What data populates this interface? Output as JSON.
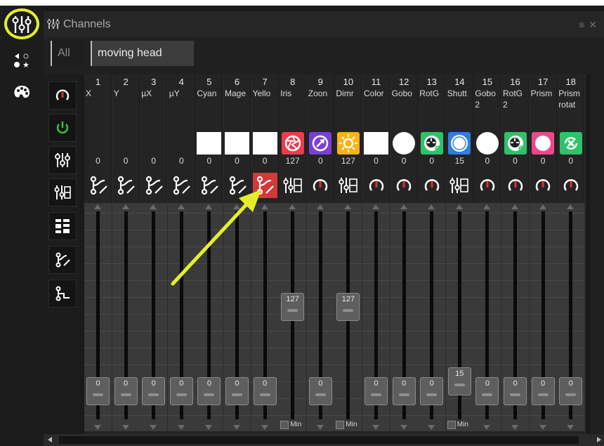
{
  "window": {
    "title": "Channels",
    "controls": [
      "≡",
      "✕"
    ]
  },
  "tabs": [
    {
      "label": "All",
      "active": false
    },
    {
      "label": "moving head",
      "active": true
    }
  ],
  "accent": "#e4ef2a",
  "left_toolbar": [
    {
      "icon": "faders-icon",
      "highlighted": true
    },
    {
      "icon": "effects-icon"
    },
    {
      "icon": "palette-icon"
    }
  ],
  "tools": [
    {
      "icon": "knob-icon"
    },
    {
      "icon": "power-icon"
    },
    {
      "icon": "faders-mode-icon"
    },
    {
      "icon": "faders-default-icon"
    },
    {
      "icon": "layout-grid-icon"
    },
    {
      "icon": "branch-curve-icon"
    },
    {
      "icon": "branch-step-icon"
    }
  ],
  "channels": [
    {
      "num": "1",
      "name": "X",
      "value": "0",
      "swatch": "none",
      "mode": "curve",
      "fader": "0"
    },
    {
      "num": "2",
      "name": "Y",
      "value": "0",
      "swatch": "none",
      "mode": "curve",
      "fader": "0"
    },
    {
      "num": "3",
      "name": "µX",
      "value": "0",
      "swatch": "none",
      "mode": "curve",
      "fader": "0"
    },
    {
      "num": "4",
      "name": "µY",
      "value": "0",
      "swatch": "none",
      "mode": "curve",
      "fader": "0"
    },
    {
      "num": "5",
      "name": "Cyan",
      "value": "0",
      "swatch": "white",
      "mode": "curve",
      "fader": "0"
    },
    {
      "num": "6",
      "name": "Mage",
      "value": "0",
      "swatch": "white",
      "mode": "curve",
      "fader": "0"
    },
    {
      "num": "7",
      "name": "Yello",
      "value": "0",
      "swatch": "white",
      "mode": "curve-red",
      "fader": "0"
    },
    {
      "num": "8",
      "name": "Iris",
      "value": "127",
      "swatch": "iris",
      "mode": "default",
      "fader": "127",
      "min_label": "Min"
    },
    {
      "num": "9",
      "name": "Zoon",
      "value": "0",
      "swatch": "zoom",
      "mode": "knob",
      "fader": "0"
    },
    {
      "num": "10",
      "name": "Dimr",
      "value": "127",
      "swatch": "dimmer",
      "mode": "default",
      "fader": "127",
      "min_label": "Min"
    },
    {
      "num": "11",
      "name": "Color",
      "value": "0",
      "swatch": "white",
      "mode": "knob",
      "fader": "0"
    },
    {
      "num": "12",
      "name": "Gobo",
      "value": "0",
      "swatch": "circle",
      "mode": "knob",
      "fader": "0"
    },
    {
      "num": "13",
      "name": "RotG",
      "value": "0",
      "swatch": "rotgobo",
      "mode": "knob",
      "fader": "0"
    },
    {
      "num": "14",
      "name": "Shutt",
      "value": "15",
      "swatch": "shutter",
      "mode": "default",
      "fader": "15",
      "min_label": "Min"
    },
    {
      "num": "15",
      "name": "Gobo 2",
      "value": "0",
      "swatch": "circle",
      "mode": "knob",
      "fader": "0"
    },
    {
      "num": "16",
      "name": "RotG 2",
      "value": "0",
      "swatch": "rotgobo",
      "mode": "knob",
      "fader": "0"
    },
    {
      "num": "17",
      "name": "Prism",
      "value": "0",
      "swatch": "prism",
      "mode": "knob",
      "fader": "0"
    },
    {
      "num": "18",
      "name": "Prism rotat",
      "value": "0",
      "swatch": "prismrot",
      "mode": "knob",
      "fader": "0"
    }
  ]
}
